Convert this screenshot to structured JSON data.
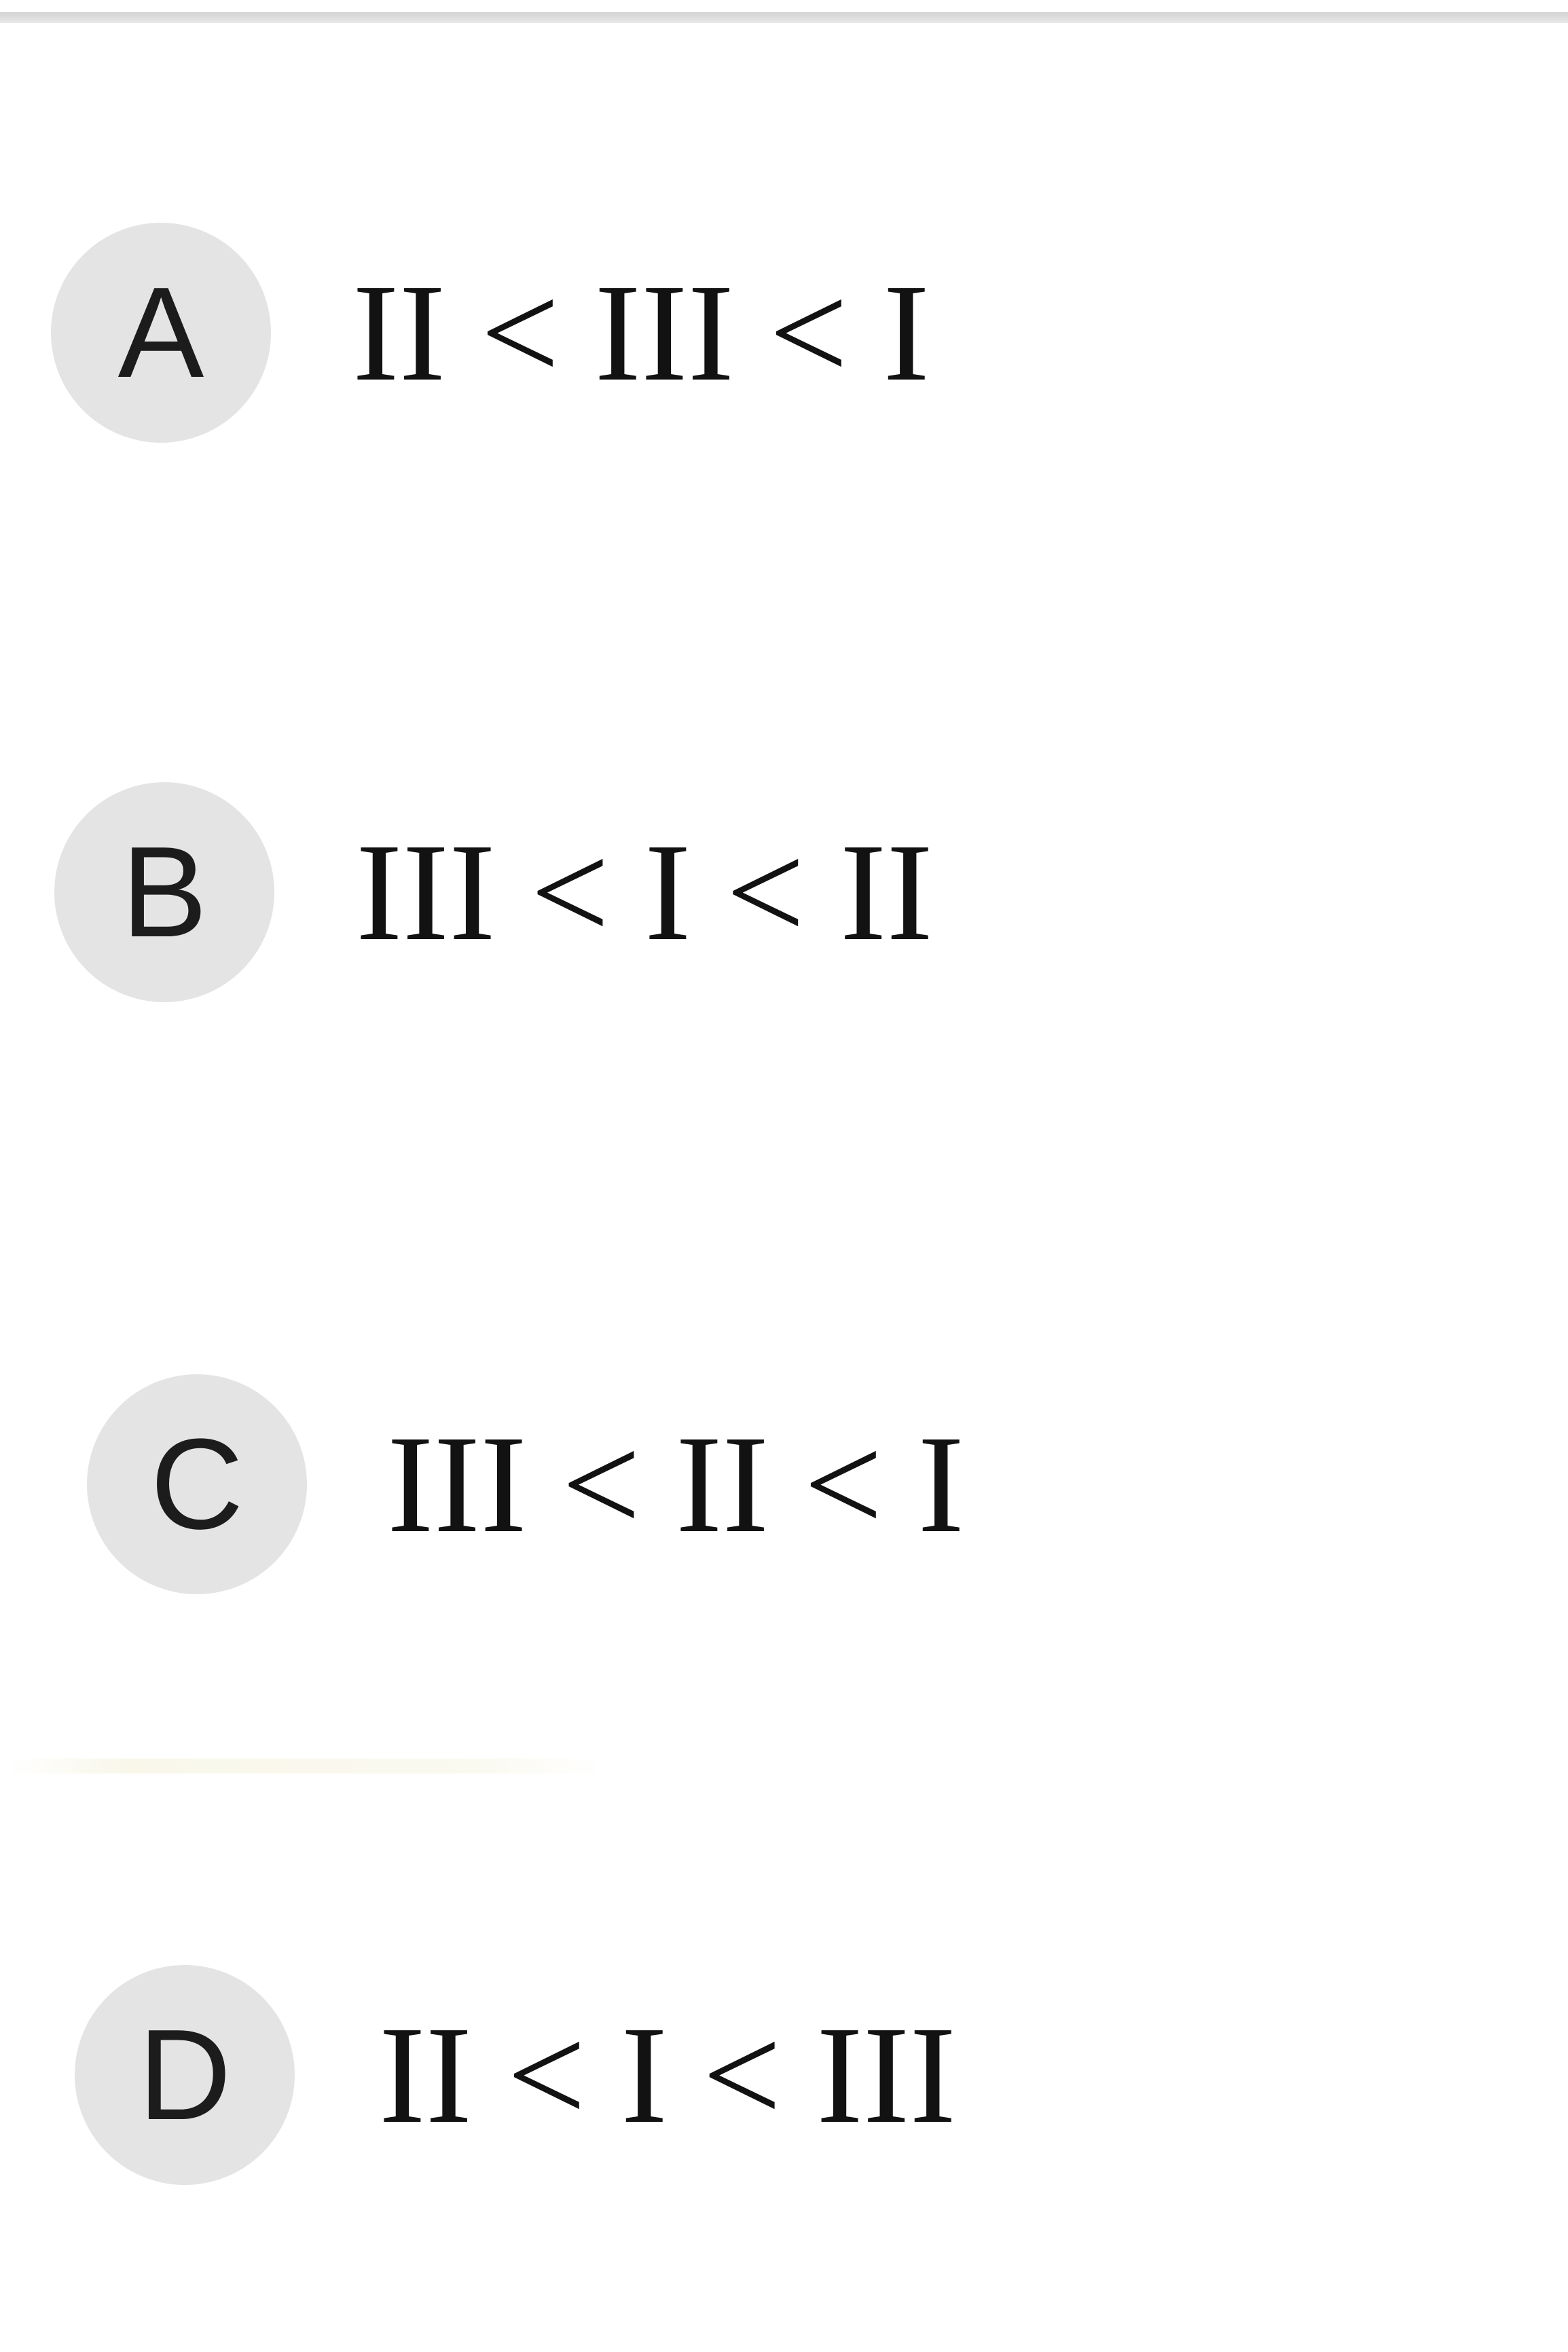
{
  "options": [
    {
      "letter": "A",
      "text": "II < III < I"
    },
    {
      "letter": "B",
      "text": "III < I < II"
    },
    {
      "letter": "C",
      "text": "III < II < I"
    },
    {
      "letter": "D",
      "text": "II < I < III"
    }
  ]
}
